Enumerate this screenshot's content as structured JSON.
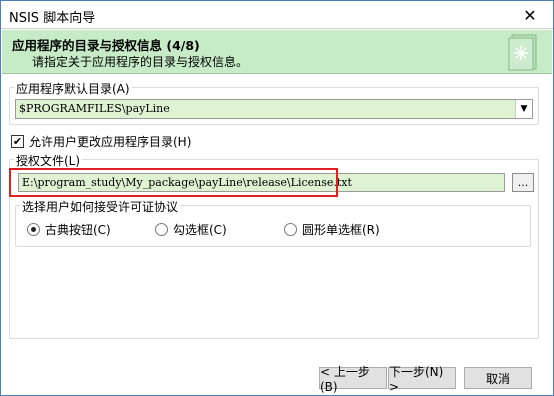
{
  "window": {
    "title": "NSIS 脚本向导",
    "close_glyph": "✕"
  },
  "header": {
    "title": "应用程序的目录与授权信息 (4/8)",
    "subtitle": "请指定关于应用程序的目录与授权信息。",
    "icon": "wizard-book-icon"
  },
  "default_dir": {
    "label": "应用程序默认目录(A)",
    "value": "$PROGRAMFILES\\payLine"
  },
  "allow_change": {
    "label": "允许用户更改应用程序目录(H)",
    "checked": true
  },
  "license": {
    "label": "授权文件(L)",
    "path": "E:\\program_study\\My_package\\payLine\\release\\License.txt",
    "browse_label": "..."
  },
  "accept_mode": {
    "label": "选择用户如何接受许可证协议",
    "options": [
      {
        "label": "古典按钮(C)",
        "selected": true
      },
      {
        "label": "勾选框(C)",
        "selected": false
      },
      {
        "label": "圆形单选框(R)",
        "selected": false
      }
    ]
  },
  "buttons": {
    "back": "< 上一步(B)",
    "next": "下一步(N) >",
    "cancel": "取消"
  },
  "colors": {
    "header_bg": "#c6ebc6",
    "field_bg": "#dff2d2",
    "highlight": "#e02020"
  }
}
